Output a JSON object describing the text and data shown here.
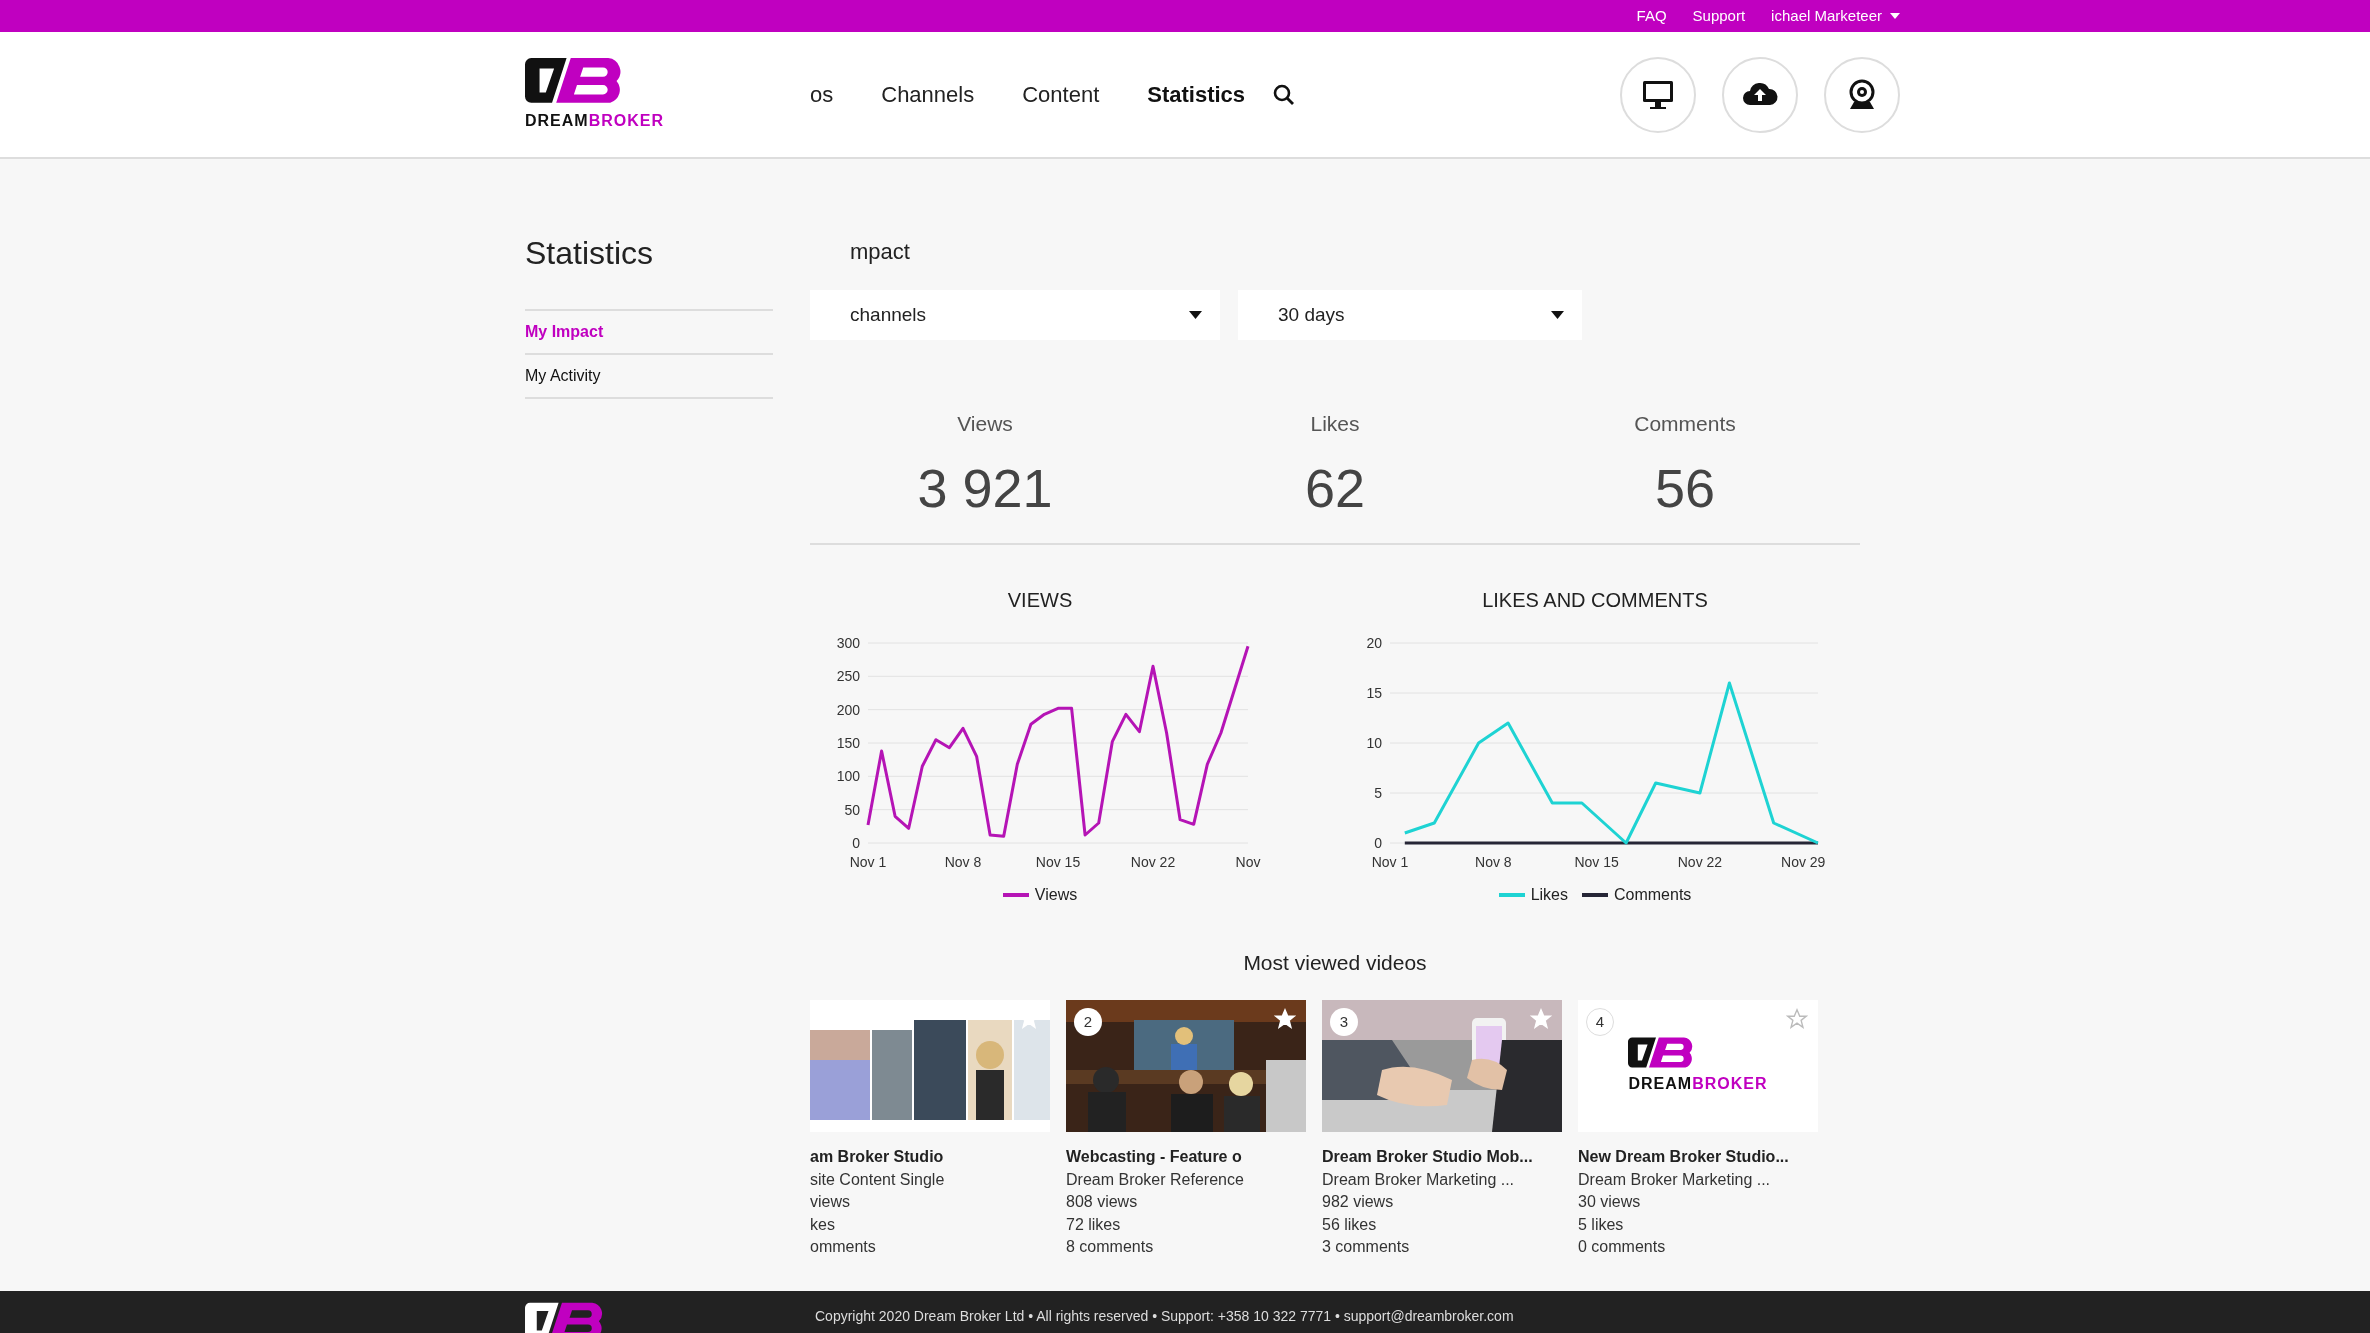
{
  "top_bar": {
    "links": [
      "FAQ",
      "Support"
    ],
    "user": "ichael Marketeer"
  },
  "header": {
    "logo": {
      "wordmark_left": "DREAM",
      "wordmark_right": "BROKER"
    },
    "nav": [
      {
        "label": "os",
        "selected": false
      },
      {
        "label": "Channels",
        "selected": false
      },
      {
        "label": "Content",
        "selected": false
      },
      {
        "label": "Statistics",
        "selected": true
      }
    ]
  },
  "sidebar": {
    "title": "Statistics",
    "items": [
      {
        "label": "My Impact",
        "selected": true
      },
      {
        "label": "My Activity",
        "selected": false
      }
    ]
  },
  "main": {
    "title": "mpact",
    "filters": [
      {
        "value": "channels"
      },
      {
        "value": "30 days"
      }
    ],
    "stats": [
      {
        "label": "Views",
        "value": "3 921"
      },
      {
        "label": "Likes",
        "value": "62"
      },
      {
        "label": "Comments",
        "value": "56"
      }
    ],
    "charts": [
      {
        "title": "VIEWS",
        "chart_data": {
          "type": "line",
          "categories": [
            "Nov 1",
            null,
            null,
            null,
            null,
            null,
            null,
            "Nov 8",
            null,
            null,
            null,
            null,
            null,
            null,
            "Nov 15",
            null,
            null,
            null,
            null,
            null,
            null,
            "Nov 22",
            null,
            null,
            null,
            null,
            null,
            null,
            "Nov"
          ],
          "grid": true,
          "ylim": [
            0,
            300
          ],
          "yticks": [
            0,
            50,
            100,
            150,
            200,
            250,
            300
          ],
          "series": [
            {
              "name": "Views",
              "color": "#b514b5",
              "values": [
                27,
                138,
                40,
                22,
                115,
                155,
                143,
                172,
                130,
                12,
                10,
                118,
                178,
                193,
                202,
                202,
                12,
                30,
                152,
                193,
                167,
                265,
                165,
                35,
                28,
                118,
                165,
                230,
                295
              ]
            }
          ]
        }
      },
      {
        "title": "LIKES AND COMMENTS",
        "chart_data": {
          "type": "line",
          "categories": [
            "Nov 1",
            null,
            null,
            null,
            null,
            null,
            null,
            "Nov 8",
            null,
            null,
            null,
            null,
            null,
            null,
            "Nov 15",
            null,
            null,
            null,
            null,
            null,
            null,
            "Nov 22",
            null,
            null,
            null,
            null,
            null,
            null,
            "Nov 29",
            null
          ],
          "grid": true,
          "ylim": [
            0,
            20
          ],
          "yticks": [
            0,
            5,
            10,
            15,
            20
          ],
          "series": [
            {
              "name": "Likes",
              "color": "#1ed3d3",
              "values": [
                null,
                1,
                null,
                2,
                null,
                null,
                10,
                null,
                12,
                null,
                null,
                4,
                null,
                4,
                null,
                null,
                0,
                null,
                6,
                null,
                null,
                5,
                null,
                16,
                null,
                null,
                2,
                null,
                null,
                0
              ]
            },
            {
              "name": "Comments",
              "color": "#262636",
              "values": [
                null,
                0,
                null,
                0,
                null,
                null,
                0,
                null,
                0,
                null,
                null,
                0,
                null,
                0,
                null,
                null,
                0,
                null,
                0,
                null,
                null,
                0,
                null,
                0,
                null,
                null,
                0,
                null,
                null,
                0
              ]
            }
          ]
        }
      }
    ],
    "videos_title": "Most viewed videos",
    "videos": [
      {
        "title": "am Broker Studio",
        "subtitle": "site Content Single",
        "views": "views",
        "likes": "kes",
        "comments": "omments"
      },
      {
        "rank": "2",
        "title": "Webcasting - Feature o",
        "subtitle": "Dream Broker Reference",
        "views": "808 views",
        "likes": "72 likes",
        "comments": "8 comments"
      },
      {
        "rank": "3",
        "title": "Dream Broker Studio Mob...",
        "subtitle": "Dream Broker Marketing ...",
        "views": "982 views",
        "likes": "56 likes",
        "comments": "3 comments"
      },
      {
        "rank": "4",
        "thumbnail": {
          "kind": "logo",
          "wordmark_left": "DREAM",
          "wordmark_right": "BROKER"
        },
        "title": "New Dream Broker Studio...",
        "subtitle": "Dream Broker Marketing ...",
        "views": "30 views",
        "likes": "5 likes",
        "comments": "0 comments"
      }
    ]
  },
  "footer": {
    "text": "Copyright 2020 Dream Broker Ltd • All rights reserved • Support: +358 10 322 7771 • support@dreambroker.com"
  }
}
